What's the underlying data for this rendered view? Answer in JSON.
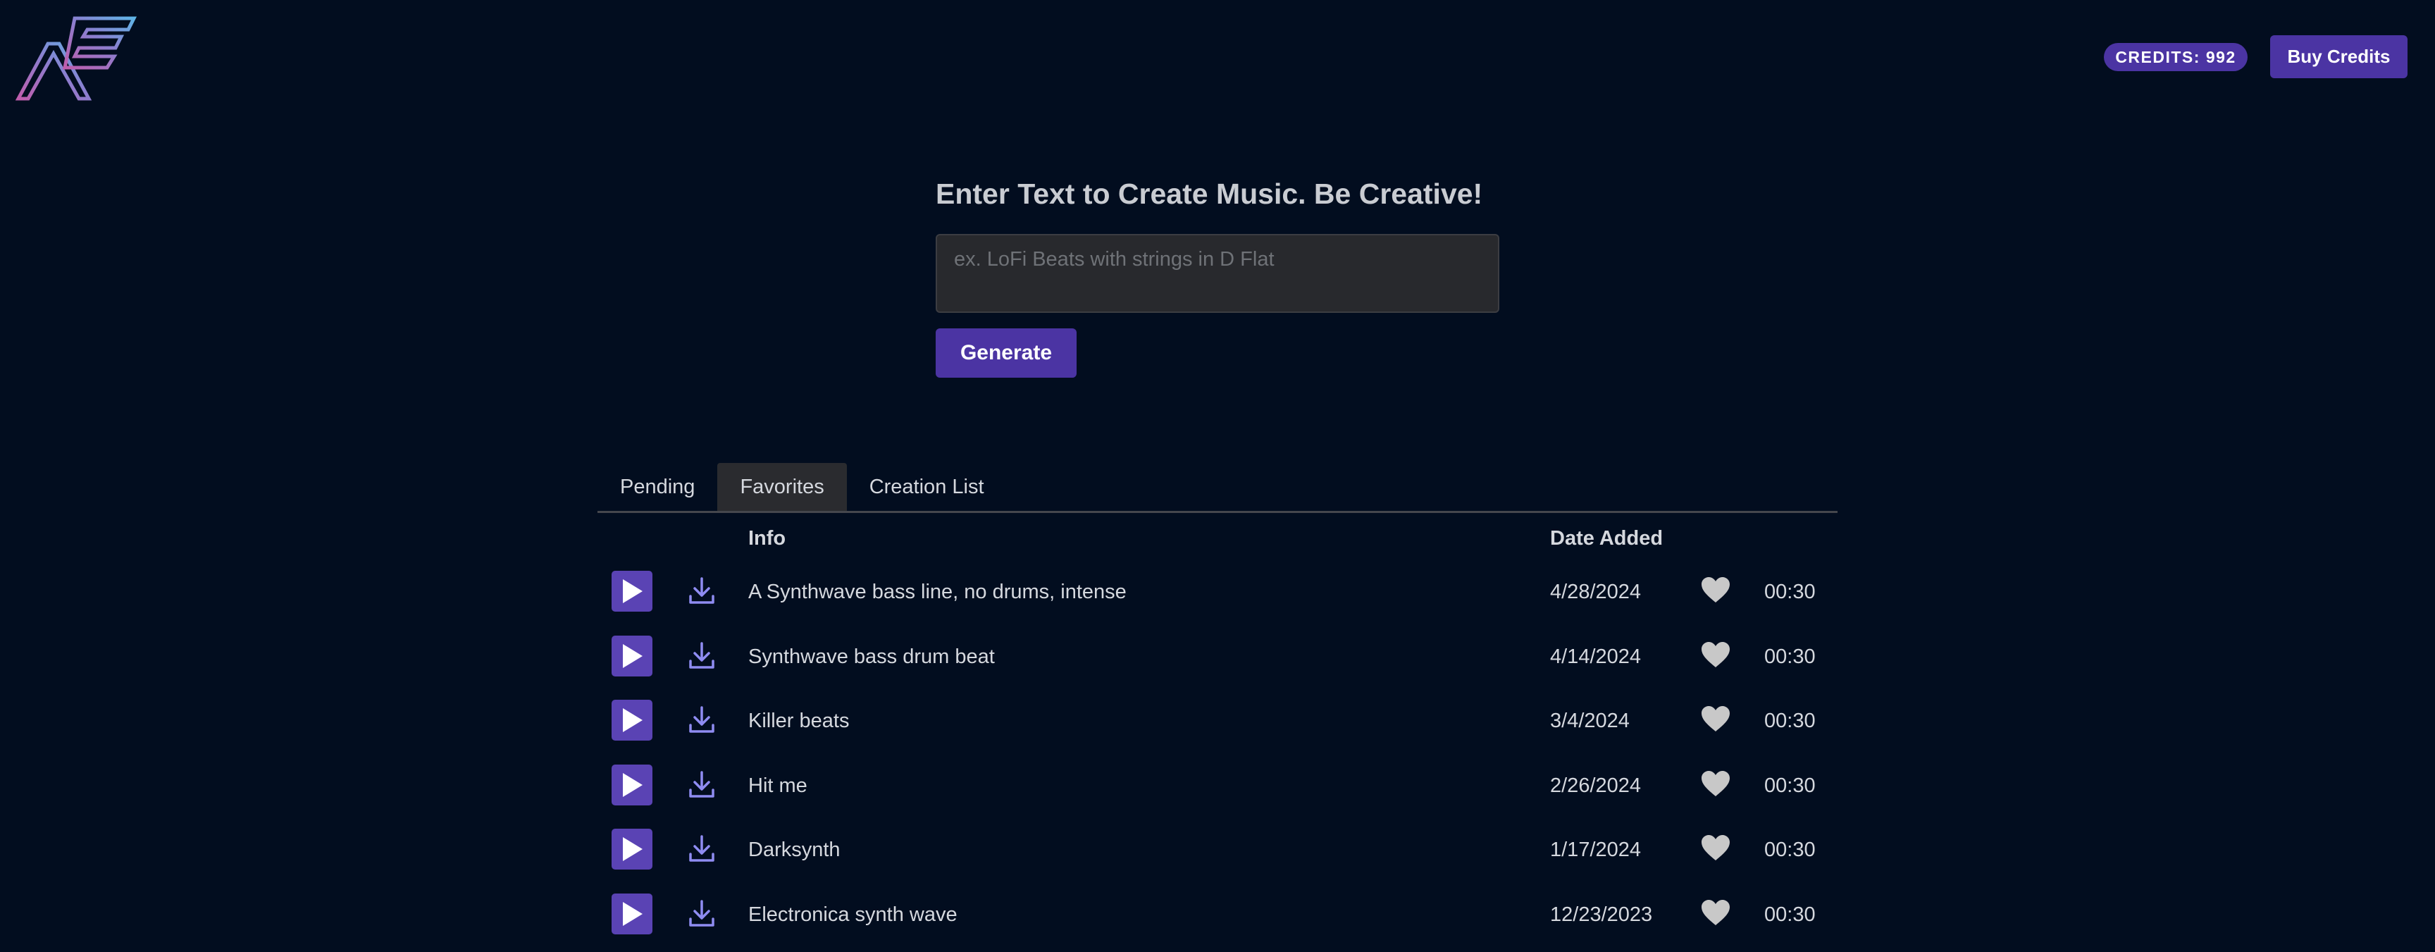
{
  "header": {
    "credits_label": "CREDITS: 992",
    "buy_label": "Buy Credits"
  },
  "create": {
    "heading": "Enter Text to Create Music. Be Creative!",
    "input_value": "",
    "input_placeholder": "ex. LoFi Beats with strings in D Flat",
    "generate_label": "Generate"
  },
  "tabs": [
    {
      "label": "Pending",
      "active": false
    },
    {
      "label": "Favorites",
      "active": true
    },
    {
      "label": "Creation List",
      "active": false
    }
  ],
  "table": {
    "columns": {
      "info": "Info",
      "date": "Date Added"
    },
    "rows": [
      {
        "info": "A Synthwave bass line, no drums, intense",
        "date": "4/28/2024",
        "duration": "00:30"
      },
      {
        "info": "Synthwave bass drum beat",
        "date": "4/14/2024",
        "duration": "00:30"
      },
      {
        "info": "Killer beats",
        "date": "3/4/2024",
        "duration": "00:30"
      },
      {
        "info": "Hit me",
        "date": "2/26/2024",
        "duration": "00:30"
      },
      {
        "info": "Darksynth",
        "date": "1/17/2024",
        "duration": "00:30"
      },
      {
        "info": "Electronica synth wave",
        "date": "12/23/2023",
        "duration": "00:30"
      }
    ]
  },
  "icons": {
    "logo": "app-logo",
    "play": "play-icon",
    "download": "download-icon",
    "favorite": "heart-icon"
  },
  "colors": {
    "background": "#020d1f",
    "accent": "#4b34a3",
    "play_button": "#5a43b4",
    "download_icon": "#8f8cf2",
    "heart": "#c8c8c8",
    "text": "#d5d8de"
  }
}
